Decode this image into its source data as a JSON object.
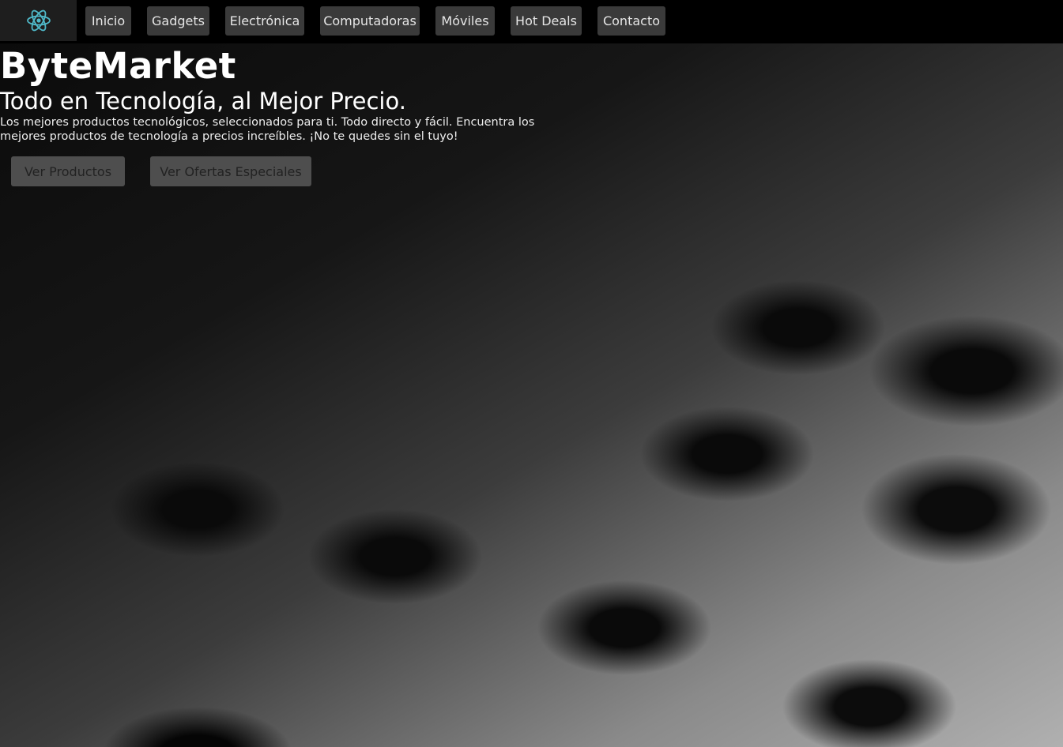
{
  "nav": {
    "logo_icon": "atom-icon",
    "logo_color": "#4fb8c8",
    "items": [
      "Inicio",
      "Gadgets",
      "Electrónica",
      "Computadoras",
      "Móviles",
      "Hot Deals",
      "Contacto"
    ]
  },
  "hero": {
    "title": "ByteMarket",
    "subtitle": "Todo en Tecnología, al Mejor Precio.",
    "description": "Los mejores productos tecnológicos, seleccionados para ti. Todo directo y fácil. Encuentra los mejores productos de tecnología a precios increíbles. ¡No te quedes sin el tuyo!",
    "buttons": [
      "Ver Productos",
      "Ver Ofertas Especiales"
    ]
  }
}
